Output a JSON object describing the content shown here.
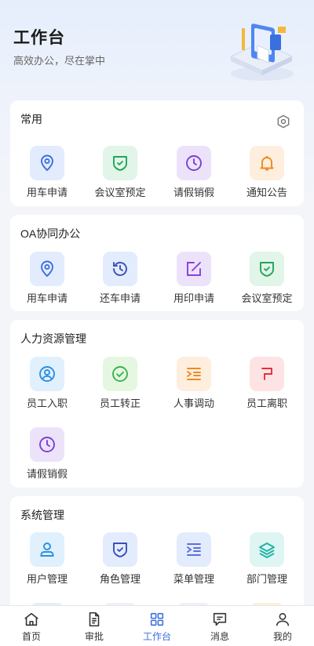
{
  "header": {
    "title": "工作台",
    "subtitle": "高效办公，尽在掌中"
  },
  "sections": [
    {
      "title": "常用",
      "items": [
        {
          "label": "用车申请",
          "icon": "location-pin-icon",
          "color": "#3b6fe0"
        },
        {
          "label": "会议室预定",
          "icon": "shield-check-icon",
          "color": "#22a55a"
        },
        {
          "label": "请假销假",
          "icon": "clock-icon",
          "color": "#7b3fd6"
        },
        {
          "label": "通知公告",
          "icon": "bell-icon",
          "color": "#f08a24"
        }
      ]
    },
    {
      "title": "OA协同办公",
      "items": [
        {
          "label": "用车申请",
          "icon": "location-pin-icon",
          "color": "#3b6fe0"
        },
        {
          "label": "还车申请",
          "icon": "history-icon",
          "color": "#3b4fb8"
        },
        {
          "label": "用印申请",
          "icon": "edit-square-icon",
          "color": "#8a3fe0"
        },
        {
          "label": "会议室预定",
          "icon": "shield-check-icon",
          "color": "#22a55a"
        }
      ]
    },
    {
      "title": "人力资源管理",
      "items": [
        {
          "label": "员工入职",
          "icon": "user-circle-icon",
          "color": "#2b8fe0"
        },
        {
          "label": "员工转正",
          "icon": "check-circle-icon",
          "color": "#3db34a"
        },
        {
          "label": "人事调动",
          "icon": "indent-list-icon",
          "color": "#f08a24"
        },
        {
          "label": "员工离职",
          "icon": "exit-bracket-icon",
          "color": "#e0343a"
        },
        {
          "label": "请假销假",
          "icon": "clock-icon",
          "color": "#7b3fd6"
        }
      ]
    },
    {
      "title": "系统管理",
      "items": [
        {
          "label": "用户管理",
          "icon": "user-icon",
          "color": "#2b8fe0"
        },
        {
          "label": "角色管理",
          "icon": "shield-check-icon",
          "color": "#3b4fb8"
        },
        {
          "label": "菜单管理",
          "icon": "indent-list-icon",
          "color": "#5b6fe0"
        },
        {
          "label": "部门管理",
          "icon": "layers-icon",
          "color": "#1fb3a5"
        }
      ]
    }
  ],
  "tabbar": {
    "items": [
      {
        "label": "首页",
        "icon": "home-icon"
      },
      {
        "label": "审批",
        "icon": "document-icon"
      },
      {
        "label": "工作台",
        "icon": "grid-icon"
      },
      {
        "label": "消息",
        "icon": "message-icon"
      },
      {
        "label": "我的",
        "icon": "person-icon"
      }
    ],
    "active": "工作台",
    "active_color": "#3b6fe0"
  }
}
